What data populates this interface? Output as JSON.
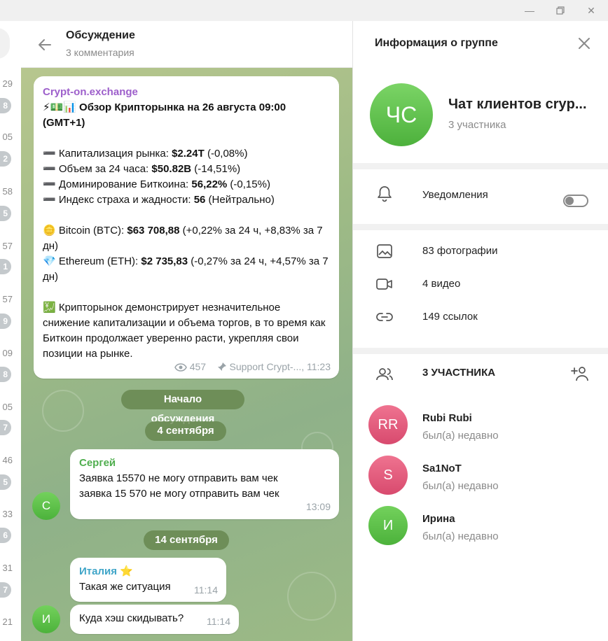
{
  "window": {
    "controls": [
      "minimize",
      "restore",
      "close"
    ]
  },
  "left_strip": {
    "times": [
      "29",
      "05",
      "58",
      "57",
      "57",
      "09",
      "05",
      "46",
      "33",
      "31",
      "21"
    ],
    "badges": [
      "8",
      "2",
      "5",
      "1",
      "9",
      "8",
      "7",
      "5",
      "6",
      "7"
    ]
  },
  "chat": {
    "title": "Обсуждение",
    "subtitle": "3 комментария",
    "post": {
      "sender": "Crypt-on.exchange",
      "headline": "⚡💵📊 Обзор Крипторынка на 26 августа 09:00 (GMT+1)",
      "stats": [
        {
          "label": "Капитализация рынка: ",
          "value": "$2.24T",
          "change": " (-0,08%)"
        },
        {
          "label": "Объем за 24 часа: ",
          "value": "$50.82B",
          "change": " (-14,51%)"
        },
        {
          "label": "Доминирование Биткоина: ",
          "value": "56,22%",
          "change": " (-0,15%)"
        },
        {
          "label": "Индекс страха и жадности: ",
          "value": "56",
          "change": " (Нейтрально)"
        }
      ],
      "coins": [
        {
          "icon": "🪙",
          "label": "Bitcoin (BTC): ",
          "value": "$63 708,88",
          "change": " (+0,22% за 24 ч, +8,83% за 7 дн)"
        },
        {
          "icon": "💎",
          "label": "Ethereum (ETH): ",
          "value": "$2 735,83",
          "change": " (-0,27% за 24 ч, +4,57% за 7 дн)"
        }
      ],
      "summary_icon": "💹",
      "summary": "Крипторынок демонстрирует незначительное снижение капитализации и объема торгов, в то время как Биткоин продолжает уверенно расти, укрепляя свои позиции на рынке.",
      "views": "457",
      "author": "Support Crypt-...",
      "time": "11:23"
    },
    "service_start": "Начало обсуждения",
    "date1": "4 сентября",
    "date2": "14 сентября",
    "messages": [
      {
        "sender": "Сергей",
        "text": "Заявка 15570 не могу отправить вам чек\nзаявка 15 570 не могу отправить вам чек",
        "time": "13:09",
        "avatar": "С",
        "color": "#4fae4e"
      },
      {
        "sender": "Италия ⭐",
        "text": "Такая же ситуация",
        "time": "11:14",
        "color": "#3fa5c8"
      },
      {
        "text": "Куда хэш скидывать?",
        "time": "11:14",
        "avatar": "И"
      }
    ]
  },
  "panel": {
    "title": "Информация о группе",
    "group_avatar": "ЧС",
    "group_name": "Чат клиентов cryp...",
    "group_members": "3 участника",
    "notifications": "Уведомления",
    "notifications_on": false,
    "media": [
      {
        "icon": "photo-icon",
        "label": "83 фотографии"
      },
      {
        "icon": "video-icon",
        "label": "4 видео"
      },
      {
        "icon": "link-icon",
        "label": "149 ссылок"
      }
    ],
    "members_header": "3 УЧАСТНИКА",
    "members": [
      {
        "initials": "RR",
        "name": "Rubi Rubi",
        "status": "был(а) недавно",
        "color": "#e2587a"
      },
      {
        "initials": "S",
        "name": "Sa1NoT",
        "status": "был(а) недавно",
        "color": "#e2587a"
      },
      {
        "initials": "И",
        "name": "Ирина",
        "status": "был(а) недавно",
        "color": "#4fba3e"
      }
    ]
  }
}
